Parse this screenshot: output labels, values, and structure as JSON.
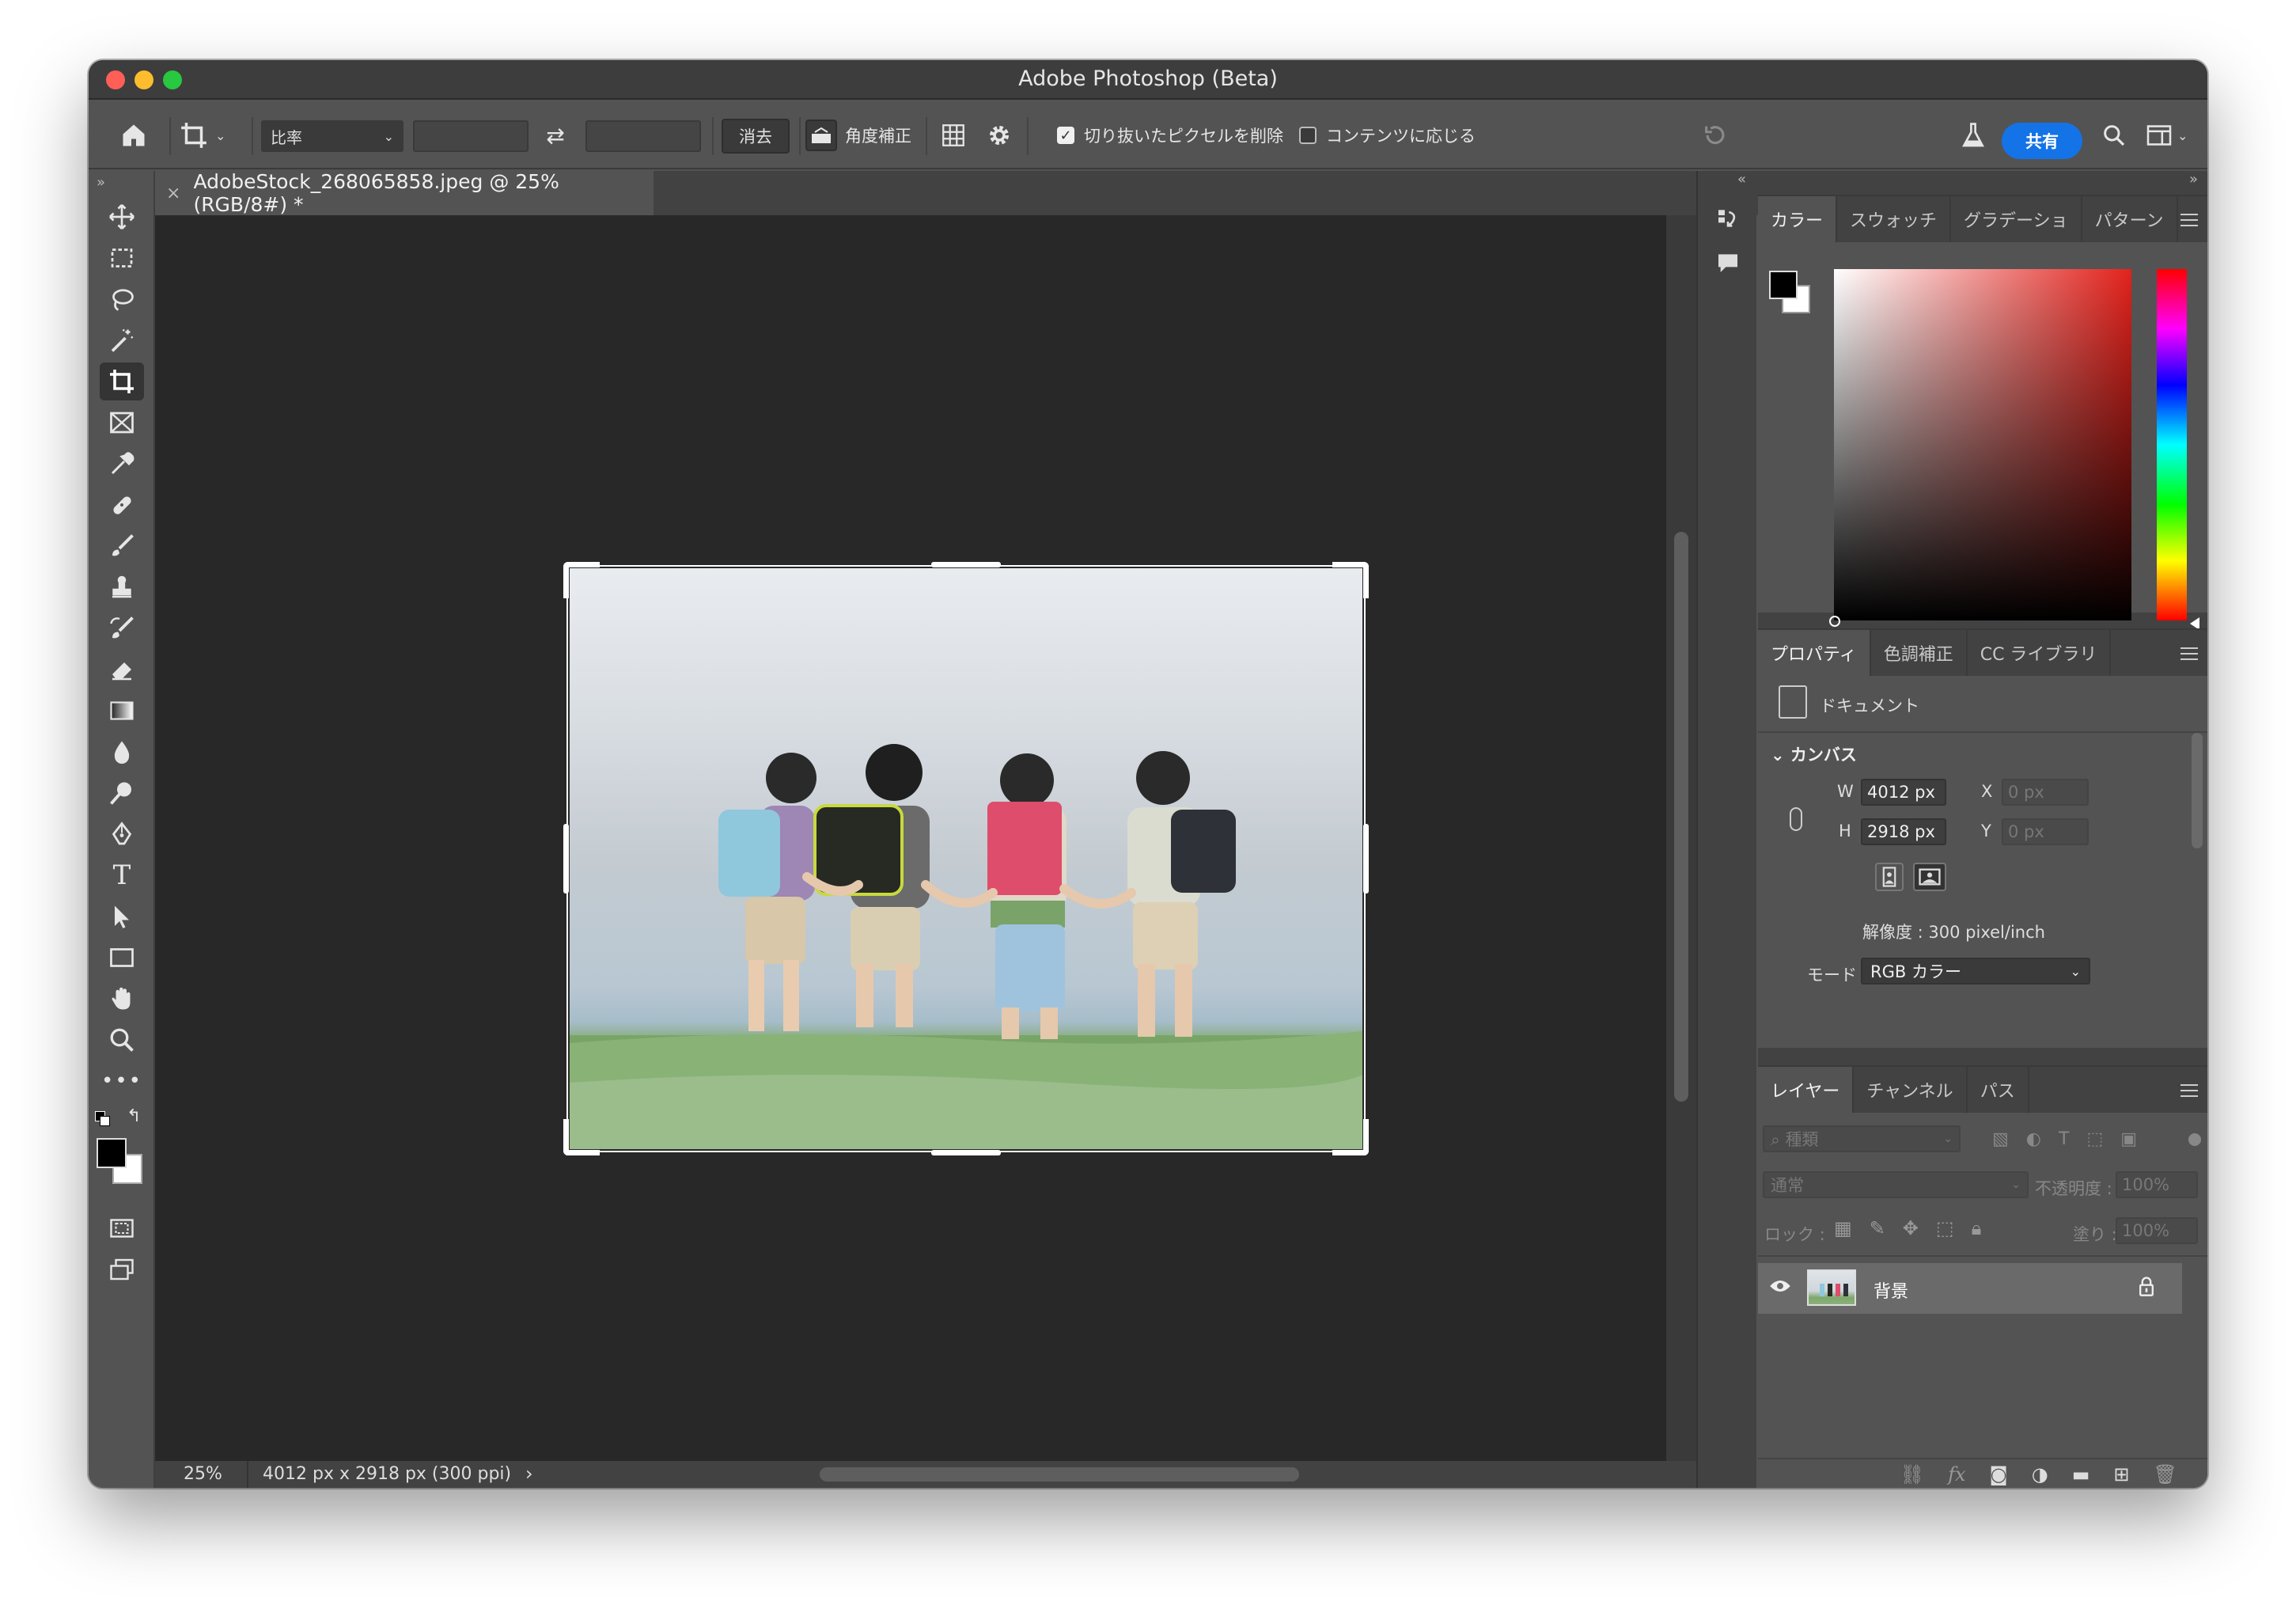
{
  "window": {
    "title": "Adobe Photoshop (Beta)",
    "traffic_colors": [
      "#ff5f57",
      "#febc2e",
      "#28c840"
    ]
  },
  "options_bar": {
    "ratio_select": "比率",
    "clear_button": "消去",
    "straighten_label": "角度補正",
    "delete_cropped_pixels": {
      "label": "切り抜いたピクセルを削除",
      "checked": true
    },
    "content_aware": {
      "label": "コンテンツに応じる",
      "checked": false
    },
    "share_button": "共有"
  },
  "toolbar": {
    "tools": [
      "move-tool",
      "marquee-tool",
      "lasso-tool",
      "magic-wand-tool",
      "crop-tool",
      "frame-tool",
      "eyedropper-tool",
      "healing-brush-tool",
      "brush-tool",
      "clone-stamp-tool",
      "history-brush-tool",
      "eraser-tool",
      "gradient-tool",
      "blur-tool",
      "dodge-tool",
      "pen-tool",
      "type-tool",
      "path-selection-tool",
      "rectangle-tool",
      "hand-tool",
      "zoom-tool",
      "more-tools"
    ],
    "active_tool": "crop-tool",
    "foreground_color": "#000000",
    "background_color": "#ffffff"
  },
  "document": {
    "tab_title": "AdobeStock_268065858.jpeg @ 25% (RGB/8#) *",
    "close_glyph": "×"
  },
  "status_bar": {
    "zoom": "25%",
    "info": "4012 px x 2918 px (300 ppi)",
    "arrow": "›"
  },
  "color_panel": {
    "tabs": [
      "カラー",
      "スウォッチ",
      "グラデーショ",
      "パターン"
    ],
    "active_tab": "カラー",
    "hue_color": "#e3221c"
  },
  "properties_panel": {
    "tabs": [
      "プロパティ",
      "色調補正",
      "CC ライブラリ"
    ],
    "active_tab": "プロパティ",
    "document_label": "ドキュメント",
    "canvas_section": "カンバス",
    "width_label": "W",
    "width_value": "4012 px",
    "height_label": "H",
    "height_value": "2918 px",
    "x_label": "X",
    "x_placeholder": "0 px",
    "y_label": "Y",
    "y_placeholder": "0 px",
    "resolution": "解像度 : 300 pixel/inch",
    "mode_label": "モード",
    "mode_value": "RGB カラー"
  },
  "layers_panel": {
    "tabs": [
      "レイヤー",
      "チャンネル",
      "パス"
    ],
    "active_tab": "レイヤー",
    "filter_placeholder": "種類",
    "blend_mode": "通常",
    "opacity_label": "不透明度 :",
    "opacity_value": "100%",
    "lock_label": "ロック :",
    "fill_label": "塗り :",
    "fill_value": "100%",
    "layers": [
      {
        "name": "背景",
        "visible": true,
        "locked": true
      }
    ]
  }
}
